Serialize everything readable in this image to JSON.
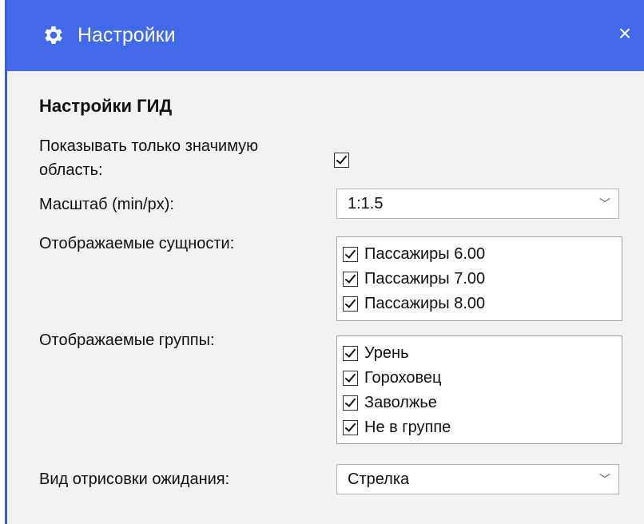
{
  "window": {
    "title": "Настройки",
    "title_icon": "gear-icon",
    "close_glyph": "×",
    "accent": "#4169e8"
  },
  "section_title": "Настройки ГИД",
  "only_significant": {
    "label_line1": "Показывать только значимую",
    "label_line2": "область:",
    "checked": true
  },
  "scale": {
    "label": "Масштаб (min/px):",
    "value": "1:1.5"
  },
  "entities": {
    "label": "Отображаемые сущности:",
    "items": [
      {
        "label": "Пассажиры 6.00",
        "checked": true
      },
      {
        "label": "Пассажиры 7.00",
        "checked": true
      },
      {
        "label": "Пассажиры 8.00",
        "checked": true
      }
    ]
  },
  "groups": {
    "label": "Отображаемые группы:",
    "items": [
      {
        "label": "Урень",
        "checked": true
      },
      {
        "label": "Гороховец",
        "checked": true
      },
      {
        "label": "Заволжье",
        "checked": true
      },
      {
        "label": "Не в группе",
        "checked": true
      }
    ]
  },
  "wait_style": {
    "label": "Вид отрисовки ожидания:",
    "value": "Стрелка"
  }
}
